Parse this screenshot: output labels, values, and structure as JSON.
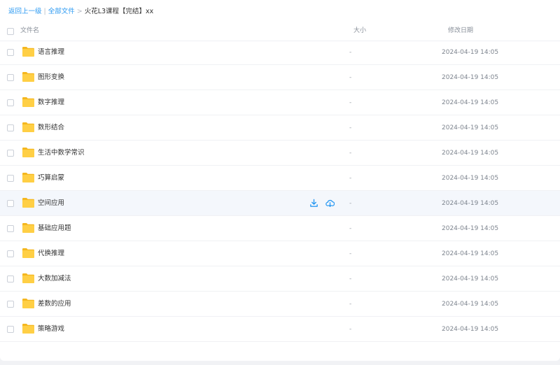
{
  "breadcrumb": {
    "back": "返回上一级",
    "separator1": "|",
    "all_files": "全部文件",
    "separator2": ">",
    "current": "火花L3课程【完结】xx"
  },
  "columns": {
    "name": "文件名",
    "size": "大小",
    "modified": "修改日期"
  },
  "colors": {
    "link": "#2c9af2",
    "folder": "#ffc93b",
    "action": "#2c9af2",
    "hover_row": "#f4f7fc"
  },
  "icons": {
    "folder": "folder-icon",
    "download": "download-icon",
    "cloud_download": "cloud-download-icon",
    "checkbox": "checkbox"
  },
  "files": [
    {
      "name": "语言推理",
      "size": "-",
      "modified": "2024-04-19 14:05"
    },
    {
      "name": "图形变换",
      "size": "-",
      "modified": "2024-04-19 14:05"
    },
    {
      "name": "数字推理",
      "size": "-",
      "modified": "2024-04-19 14:05"
    },
    {
      "name": "数形结合",
      "size": "-",
      "modified": "2024-04-19 14:05"
    },
    {
      "name": "生活中数学常识",
      "size": "-",
      "modified": "2024-04-19 14:05"
    },
    {
      "name": "巧算启蒙",
      "size": "-",
      "modified": "2024-04-19 14:05"
    },
    {
      "name": "空间应用",
      "size": "-",
      "modified": "2024-04-19 14:05"
    },
    {
      "name": "基础应用题",
      "size": "-",
      "modified": "2024-04-19 14:05"
    },
    {
      "name": "代换推理",
      "size": "-",
      "modified": "2024-04-19 14:05"
    },
    {
      "name": "大数加减法",
      "size": "-",
      "modified": "2024-04-19 14:05"
    },
    {
      "name": "差数的应用",
      "size": "-",
      "modified": "2024-04-19 14:05"
    },
    {
      "name": "策略游戏",
      "size": "-",
      "modified": "2024-04-19 14:05"
    }
  ],
  "active_row": 6
}
